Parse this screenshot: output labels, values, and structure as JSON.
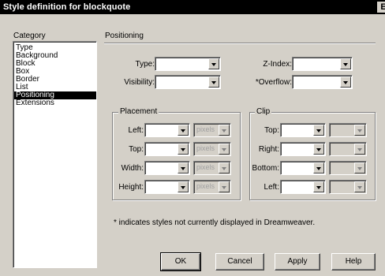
{
  "window": {
    "title": "Style definition for blockquote",
    "title_button": "E"
  },
  "category": {
    "label": "Category",
    "items": [
      "Type",
      "Background",
      "Block",
      "Box",
      "Border",
      "List",
      "Positioning",
      "Extensions"
    ],
    "selected": "Positioning"
  },
  "section": {
    "title": "Positioning"
  },
  "fields": {
    "type_label": "Type:",
    "visibility_label": "Visibility:",
    "zindex_label": "Z-Index:",
    "overflow_label": "*Overflow:"
  },
  "placement": {
    "title": "Placement",
    "left_label": "Left:",
    "top_label": "Top:",
    "width_label": "Width:",
    "height_label": "Height:",
    "unit": "pixels"
  },
  "clip": {
    "title": "Clip",
    "top_label": "Top:",
    "right_label": "Right:",
    "bottom_label": "Bottom:",
    "left_label": "Left:"
  },
  "note": "* indicates styles not currently displayed in Dreamweaver.",
  "buttons": {
    "ok": "OK",
    "cancel": "Cancel",
    "apply": "Apply",
    "help": "Help"
  }
}
